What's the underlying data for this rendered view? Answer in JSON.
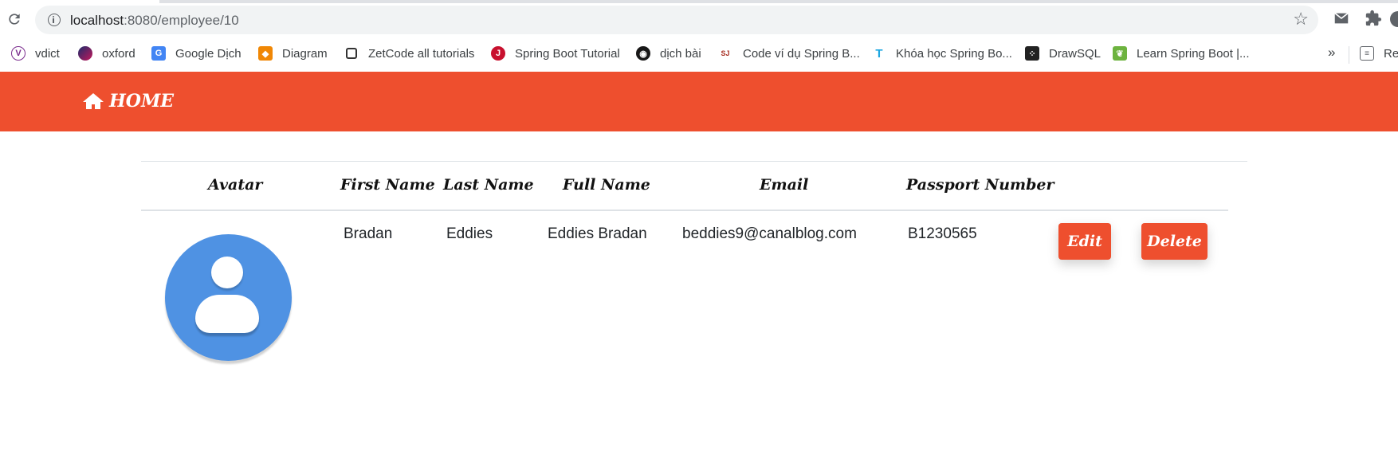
{
  "browser": {
    "url_host": "localhost",
    "url_path": ":8080/employee/10",
    "bookmarks": [
      {
        "label": "vdict",
        "icon": "vdict-icon",
        "color": "#7b2d8e"
      },
      {
        "label": "oxford",
        "icon": "oxford-icon",
        "color": "#1d2c6b"
      },
      {
        "label": "Google Dịch",
        "icon": "google-translate-icon",
        "color": "#4285f4"
      },
      {
        "label": "Diagram",
        "icon": "diagram-icon",
        "color": "#f08705"
      },
      {
        "label": "ZetCode all tutorials",
        "icon": "zetcode-icon",
        "color": "#333333"
      },
      {
        "label": "Spring Boot Tutorial",
        "icon": "spring-boot-tutorial-icon",
        "color": "#c8102e"
      },
      {
        "label": "dịch bài",
        "icon": "github-icon",
        "color": "#181717"
      },
      {
        "label": "Code ví dụ Spring B...",
        "icon": "sj-icon",
        "color": "#a93226"
      },
      {
        "label": "Khóa học Spring Bo...",
        "icon": "course-icon",
        "color": "#1ea7e1"
      },
      {
        "label": "DrawSQL",
        "icon": "drawsql-icon",
        "color": "#222222"
      },
      {
        "label": "Learn Spring Boot |...",
        "icon": "leaf-icon",
        "color": "#6db33f"
      }
    ],
    "more_label": "»",
    "reading_list_label": "Re"
  },
  "nav": {
    "home_label": "HOME",
    "color": "#ee4f2e"
  },
  "table": {
    "headers": {
      "avatar": "Avatar",
      "first_name": "First Name",
      "last_name": "Last Name",
      "full_name": "Full Name",
      "email": "Email",
      "passport": "Passport Number"
    },
    "row": {
      "first_name": "Bradan",
      "last_name": "Eddies",
      "full_name": "Eddies Bradan",
      "email": "beddies9@canalblog.com",
      "passport": "B1230565",
      "edit_label": "Edit",
      "delete_label": "Delete"
    }
  }
}
